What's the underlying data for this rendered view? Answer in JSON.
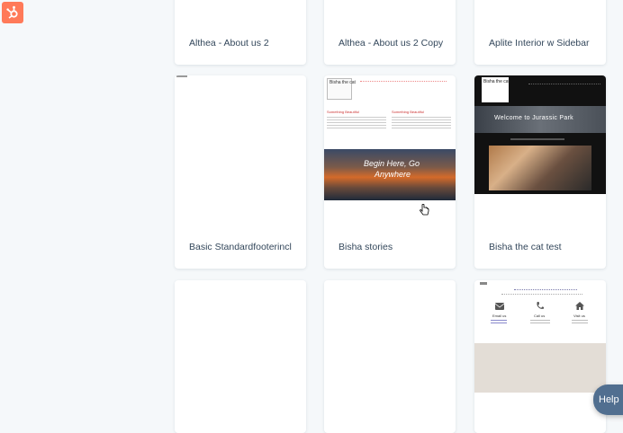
{
  "app": {
    "logo_icon": "hubspot-sprocket-icon",
    "accent": "#ff7a59"
  },
  "templates": [
    {
      "label": "Althea - About us 2"
    },
    {
      "label": "Althea - About us 2 Copy"
    },
    {
      "label": "Aplite Interior w Sidebar"
    },
    {
      "label": "Basic Standardfooterincl"
    },
    {
      "label": "Bisha stories",
      "thumb": {
        "logo": "Bisha the cat",
        "heading_left": "Something Beautiful",
        "heading_right": "Something Beautiful",
        "banner_line1": "Begin Here, Go",
        "banner_line2": "Anywhere"
      }
    },
    {
      "label": "Bisha the cat test",
      "thumb": {
        "logo": "Bisha the cat",
        "title": "Welcome to Jurassic Park"
      }
    },
    {
      "label": ""
    },
    {
      "label": ""
    },
    {
      "label": "",
      "thumb": {
        "contact": [
          "Email us",
          "Call us",
          "Visit us"
        ]
      }
    }
  ],
  "help": {
    "label": "Help"
  }
}
